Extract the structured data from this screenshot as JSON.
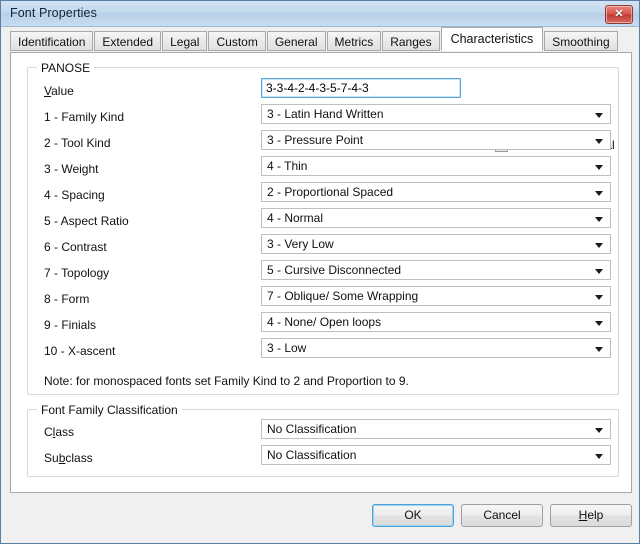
{
  "window": {
    "title": "Font Properties",
    "close_label": "✕"
  },
  "tabs": [
    {
      "label": "Identification",
      "selected": false
    },
    {
      "label": "Extended",
      "selected": false
    },
    {
      "label": "Legal",
      "selected": false
    },
    {
      "label": "Custom",
      "selected": false
    },
    {
      "label": "General",
      "selected": false
    },
    {
      "label": "Metrics",
      "selected": false
    },
    {
      "label": "Ranges",
      "selected": false
    },
    {
      "label": "Characteristics",
      "selected": true
    },
    {
      "label": "Smoothing",
      "selected": false
    }
  ],
  "panose": {
    "group_title": "PANOSE",
    "value_label_pre": "V",
    "value_label_post": "alue",
    "value": "3-3-4-2-4-3-5-7-4-3",
    "show_hex_label": "Show hexadecimal",
    "show_hex_checked": false,
    "rows": [
      {
        "label": "1 - Family Kind",
        "value": "3 - Latin Hand Written"
      },
      {
        "label": "2 - Tool Kind",
        "value": "3 - Pressure Point"
      },
      {
        "label": "3 - Weight",
        "value": "4 - Thin"
      },
      {
        "label": "4 - Spacing",
        "value": "2 - Proportional Spaced"
      },
      {
        "label": "5 - Aspect Ratio",
        "value": "4 - Normal"
      },
      {
        "label": "6 - Contrast",
        "value": "3 - Very Low"
      },
      {
        "label": "7 - Topology",
        "value": "5 - Cursive Disconnected"
      },
      {
        "label": "8 - Form",
        "value": "7 - Oblique/ Some Wrapping"
      },
      {
        "label": "9 - Finials",
        "value": "4 - None/ Open loops"
      },
      {
        "label": "10 - X-ascent",
        "value": "3 - Low"
      }
    ],
    "note": "Note: for monospaced fonts set Family Kind to 2 and Proportion to 9."
  },
  "classification": {
    "group_title": "Font Family Classification",
    "class_label_pre": "C",
    "class_label_mid": "l",
    "class_label_post": "ass",
    "class_value": "No Classification",
    "subclass_label_a": "S",
    "subclass_label_b": "u",
    "subclass_label_c": "b",
    "subclass_label_d": "class",
    "subclass_value": "No Classification"
  },
  "footer": {
    "ok_label": "OK",
    "cancel_label": "Cancel",
    "help_label_pre": "H",
    "help_label_post": "elp"
  },
  "colors": {
    "titlebar_top": "#d3e3f2",
    "titlebar_bottom": "#c9dcef",
    "close_red": "#d5534c",
    "focus_blue": "#5ba7d9",
    "panel_bg": "#f0f0f0",
    "page_bg": "#ffffff"
  }
}
